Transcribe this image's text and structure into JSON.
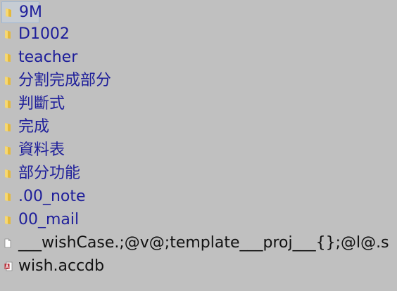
{
  "items": [
    {
      "label": "9M",
      "kind": "folder",
      "icon": "folder-icon",
      "selected": true
    },
    {
      "label": "D1002",
      "kind": "folder",
      "icon": "folder-icon"
    },
    {
      "label": "teacher",
      "kind": "folder",
      "icon": "folder-icon"
    },
    {
      "label": "分割完成部分",
      "kind": "folder",
      "icon": "folder-icon"
    },
    {
      "label": "判斷式",
      "kind": "folder",
      "icon": "folder-icon"
    },
    {
      "label": "完成",
      "kind": "folder",
      "icon": "folder-icon"
    },
    {
      "label": "資料表",
      "kind": "folder",
      "icon": "folder-icon"
    },
    {
      "label": "部分功能",
      "kind": "folder",
      "icon": "folder-icon"
    },
    {
      "label": ".00_note",
      "kind": "folder",
      "icon": "folder-icon"
    },
    {
      "label": "00_mail",
      "kind": "folder",
      "icon": "folder-icon"
    },
    {
      "label": "___wishCase.;@v@;template___proj___{};@l@.s",
      "kind": "file",
      "icon": "blank-file-icon"
    },
    {
      "label": "wish.accdb",
      "kind": "file",
      "icon": "access-file-icon"
    }
  ],
  "colors": {
    "background": "#c0c0c0",
    "folder_text": "#1e1e9a",
    "file_text": "#111111",
    "folder_icon": "#f2cc55",
    "selection_border": "#9fb6d3"
  }
}
